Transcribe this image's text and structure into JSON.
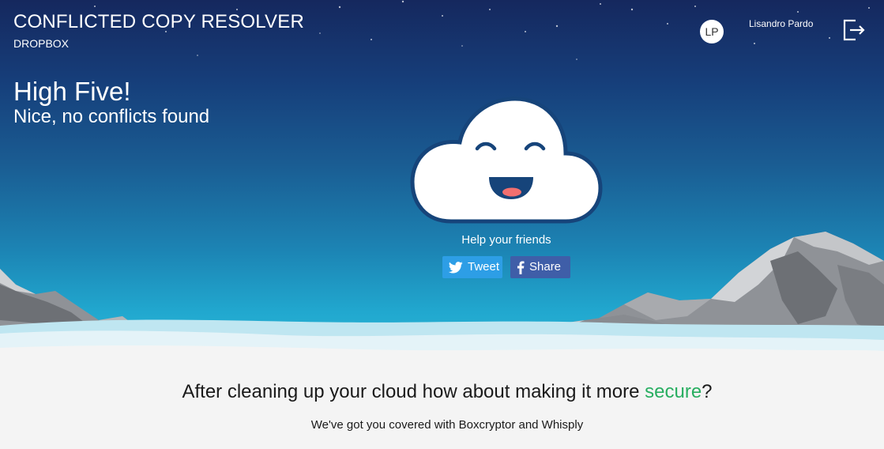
{
  "header": {
    "app_title": "CONFLICTED COPY RESOLVER",
    "app_subtitle": "DROPBOX",
    "user": {
      "initials": "LP",
      "name": "Lisandro Pardo"
    },
    "logout_icon": "logout-icon"
  },
  "hero": {
    "headline": "High Five!",
    "subheadline": "Nice, no conflicts found",
    "illustration": "smiling-cloud",
    "help_text": "Help your friends",
    "tweet_label": "Tweet",
    "share_label": "Share"
  },
  "promo": {
    "headline_before": "After cleaning up your cloud how about making it more ",
    "headline_accent": "secure",
    "headline_after": "?",
    "subtext": "We've got you covered with Boxcryptor and Whisply"
  },
  "colors": {
    "sky_top": "#15285e",
    "sky_bottom": "#2fbad8",
    "tweet_button": "#2d9ee6",
    "facebook_button": "#3f5ea8",
    "accent_green": "#27ae60"
  }
}
